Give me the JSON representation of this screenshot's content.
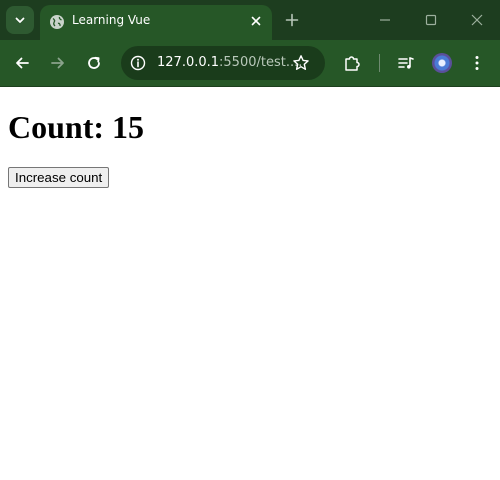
{
  "browser": {
    "tab": {
      "title": "Learning Vue",
      "favicon": "globe-icon"
    },
    "address_bar": {
      "host": "127.0.0.1",
      "path": ":5500/test...."
    },
    "icons": {
      "tab_search": "chevron-down-icon",
      "new_tab": "plus-icon",
      "minimize": "minimize-icon",
      "maximize": "maximize-icon",
      "close": "close-icon",
      "back": "back-arrow-icon",
      "forward": "forward-arrow-icon",
      "reload": "reload-icon",
      "site_info": "info-icon",
      "bookmark": "star-icon",
      "extensions": "puzzle-icon",
      "media_controls": "playlist-icon",
      "profile": "avatar",
      "menu": "kebab-menu-icon"
    },
    "colors": {
      "frame": "#1d3d1f",
      "toolbar": "#265727",
      "omnibox": "#1a3c1b"
    }
  },
  "page": {
    "heading_label": "Count:",
    "count": "15",
    "increase_button_label": "Increase count"
  }
}
